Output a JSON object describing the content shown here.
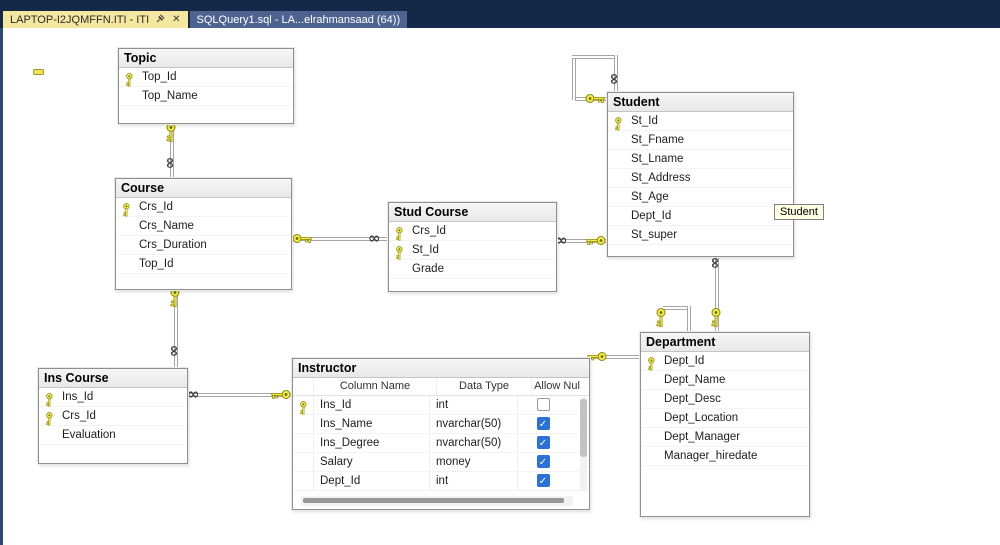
{
  "window": {
    "tabs": [
      {
        "label": "LAPTOP-I2JQMFFN.ITI - ITI",
        "state": "active"
      },
      {
        "label": "SQLQuery1.sql - LA...elrahmansaad (64))",
        "state": "inactive"
      }
    ]
  },
  "tooltip": {
    "text": "Student"
  },
  "colors": {
    "tabbar_bg": "#142947",
    "tab_active_bg": "#f6e7a0",
    "tab_inactive_bg": "#4d6390",
    "key_yellow": "#f2ec4f",
    "checkbox_blue": "#2a72d8",
    "tooltip_bg": "#ffffe1",
    "relationship_line": "#a6a6a6"
  },
  "diagram": {
    "tables": [
      {
        "id": "topic",
        "name": "Topic",
        "columns": [
          {
            "name": "Top_Id",
            "key": true
          },
          {
            "name": "Top_Name",
            "key": false
          }
        ]
      },
      {
        "id": "course",
        "name": "Course",
        "columns": [
          {
            "name": "Crs_Id",
            "key": true
          },
          {
            "name": "Crs_Name",
            "key": false
          },
          {
            "name": "Crs_Duration",
            "key": false
          },
          {
            "name": "Top_Id",
            "key": false
          }
        ]
      },
      {
        "id": "stud_course",
        "name": "Stud Course",
        "columns": [
          {
            "name": "Crs_Id",
            "key": true
          },
          {
            "name": "St_Id",
            "key": true
          },
          {
            "name": "Grade",
            "key": false
          }
        ]
      },
      {
        "id": "student",
        "name": "Student",
        "columns": [
          {
            "name": "St_Id",
            "key": true
          },
          {
            "name": "St_Fname",
            "key": false
          },
          {
            "name": "St_Lname",
            "key": false
          },
          {
            "name": "St_Address",
            "key": false
          },
          {
            "name": "St_Age",
            "key": false
          },
          {
            "name": "Dept_Id",
            "key": false
          },
          {
            "name": "St_super",
            "key": false
          }
        ]
      },
      {
        "id": "ins_course",
        "name": "Ins Course",
        "columns": [
          {
            "name": "Ins_Id",
            "key": true
          },
          {
            "name": "Crs_Id",
            "key": true
          },
          {
            "name": "Evaluation",
            "key": false
          }
        ]
      },
      {
        "id": "department",
        "name": "Department",
        "columns": [
          {
            "name": "Dept_Id",
            "key": true
          },
          {
            "name": "Dept_Name",
            "key": false
          },
          {
            "name": "Dept_Desc",
            "key": false
          },
          {
            "name": "Dept_Location",
            "key": false
          },
          {
            "name": "Dept_Manager",
            "key": false
          },
          {
            "name": "Manager_hiredate",
            "key": false
          }
        ]
      }
    ],
    "grid_table": {
      "id": "instructor",
      "name": "Instructor",
      "headers": [
        "Column Name",
        "Data Type",
        "Allow Nul"
      ],
      "rows": [
        {
          "key": true,
          "column": "Ins_Id",
          "type": "int",
          "nullable": false
        },
        {
          "key": false,
          "column": "Ins_Name",
          "type": "nvarchar(50)",
          "nullable": true
        },
        {
          "key": false,
          "column": "Ins_Degree",
          "type": "nvarchar(50)",
          "nullable": true
        },
        {
          "key": false,
          "column": "Salary",
          "type": "money",
          "nullable": true
        },
        {
          "key": false,
          "column": "Dept_Id",
          "type": "int",
          "nullable": true
        }
      ]
    },
    "relationships": [
      {
        "one": "Topic",
        "many": "Course"
      },
      {
        "one": "Course",
        "many": "Stud Course"
      },
      {
        "one": "Student",
        "many": "Stud Course"
      },
      {
        "one": "Course",
        "many": "Ins Course"
      },
      {
        "one": "Instructor",
        "many": "Ins Course"
      },
      {
        "one": "Department",
        "many": "Instructor"
      },
      {
        "one": "Department",
        "many": "Student"
      },
      {
        "one": "Student",
        "many": "Student",
        "type": "self"
      },
      {
        "one": "Department",
        "many": "Department",
        "type": "self"
      }
    ]
  }
}
